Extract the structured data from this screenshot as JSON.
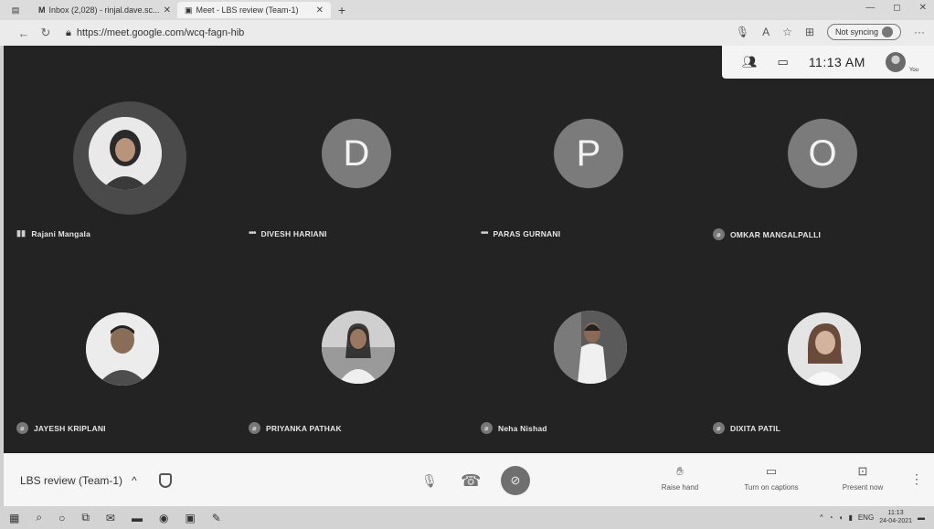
{
  "browser": {
    "tabs": [
      {
        "icon": "mail-icon",
        "label": "Inbox (2,028) - rinjal.dave.sc..."
      },
      {
        "icon": "meet-icon",
        "label": "Meet - LBS review (Team-1)"
      }
    ],
    "new_tab": "+",
    "url": "https://meet.google.com/wcq-fagn-hib",
    "sync_label": "Not syncing"
  },
  "meeting": {
    "time": "11:13 AM",
    "you_label": "You",
    "name": "LBS review (Team-1)",
    "participants": [
      {
        "name": "Rajani Mangala",
        "type": "photo",
        "status": "speaking"
      },
      {
        "name": "DIVESH HARIANI",
        "type": "letter",
        "letter": "D",
        "status": "more"
      },
      {
        "name": "PARAS GURNANI",
        "type": "letter",
        "letter": "P",
        "status": "more"
      },
      {
        "name": "OMKAR MANGALPALLI",
        "type": "letter",
        "letter": "O",
        "status": "muted"
      },
      {
        "name": "JAYESH KRIPLANI",
        "type": "photo",
        "status": "muted"
      },
      {
        "name": "PRIYANKA PATHAK",
        "type": "photo",
        "status": "muted"
      },
      {
        "name": "Neha Nishad",
        "type": "photo",
        "status": "muted"
      },
      {
        "name": "DIXITA PATIL",
        "type": "photo",
        "status": "muted"
      }
    ],
    "controls": {
      "raise_hand": "Raise hand",
      "captions": "Turn on captions",
      "present": "Present now"
    }
  },
  "taskbar": {
    "lang": "ENG",
    "time": "11:13",
    "date": "24-04-2021"
  }
}
